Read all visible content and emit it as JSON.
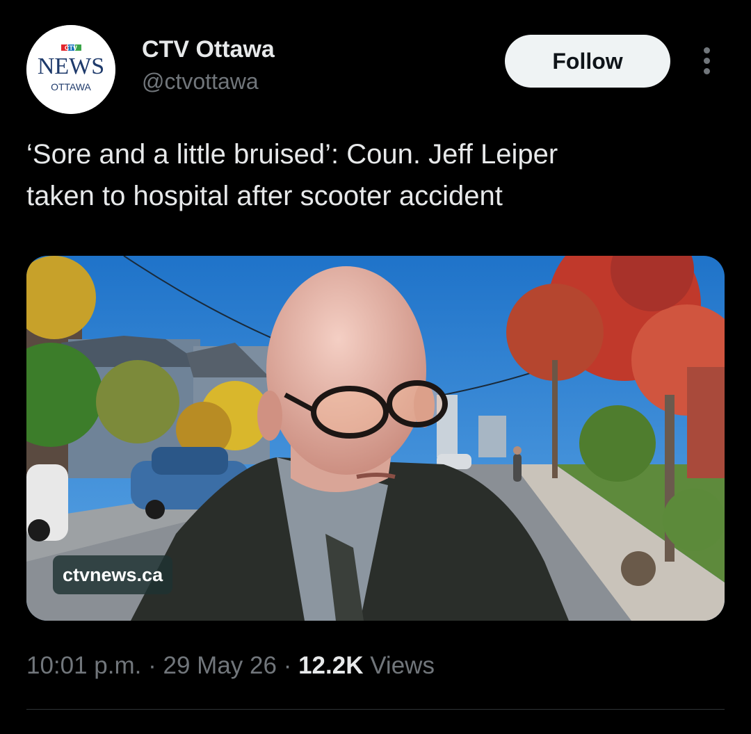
{
  "author": {
    "display_name": "CTV Ottawa",
    "handle": "@ctvottawa",
    "avatar_logo": {
      "brand": "CTV",
      "news": "NEWS",
      "city": "OTTAWA"
    }
  },
  "actions": {
    "follow_label": "Follow",
    "more_icon": "more-vertical-icon"
  },
  "tweet": {
    "text": "‘Sore and a little bruised’: Coun. Jeff Leiper\ntaken to hospital after scooter accident"
  },
  "media": {
    "source_label": "ctvnews.ca"
  },
  "meta": {
    "time": "10:01 p.m.",
    "separator": "·",
    "date": "29 May 26",
    "views_count": "12.2K",
    "views_label": "Views"
  },
  "colors": {
    "background": "#000000",
    "text_primary": "#e7e9ea",
    "text_secondary": "#71767b",
    "follow_button_bg": "#eff3f4",
    "divider": "#2f3336"
  }
}
